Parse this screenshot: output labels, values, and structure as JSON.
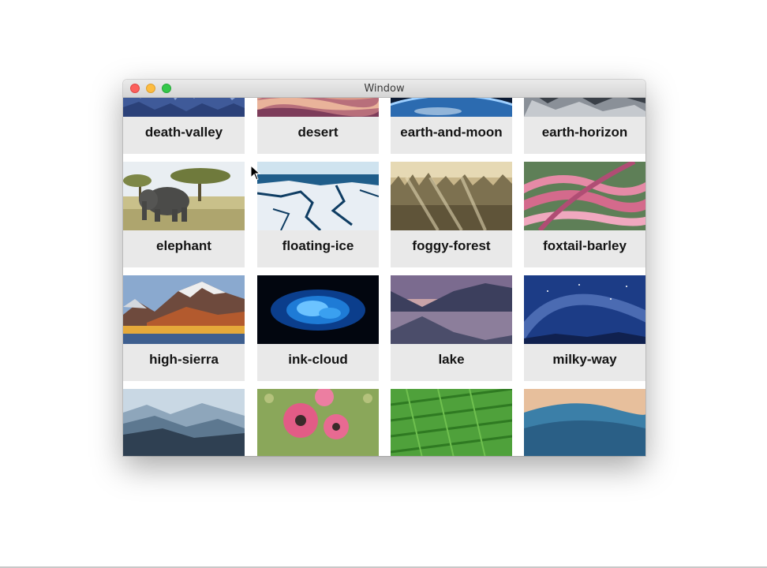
{
  "window": {
    "title": "Window"
  },
  "wallpapers": [
    {
      "label": "death-valley",
      "icon": "death-valley-thumbnail"
    },
    {
      "label": "desert",
      "icon": "desert-thumbnail"
    },
    {
      "label": "earth-and-moon",
      "icon": "earth-and-moon-thumbnail"
    },
    {
      "label": "earth-horizon",
      "icon": "earth-horizon-thumbnail"
    },
    {
      "label": "elephant",
      "icon": "elephant-thumbnail"
    },
    {
      "label": "floating-ice",
      "icon": "floating-ice-thumbnail"
    },
    {
      "label": "foggy-forest",
      "icon": "foggy-forest-thumbnail"
    },
    {
      "label": "foxtail-barley",
      "icon": "foxtail-barley-thumbnail"
    },
    {
      "label": "high-sierra",
      "icon": "high-sierra-thumbnail"
    },
    {
      "label": "ink-cloud",
      "icon": "ink-cloud-thumbnail"
    },
    {
      "label": "lake",
      "icon": "lake-thumbnail"
    },
    {
      "label": "milky-way",
      "icon": "milky-way-thumbnail"
    },
    {
      "icon": "misty-mountains-thumbnail"
    },
    {
      "icon": "poppy-flowers-thumbnail"
    },
    {
      "icon": "green-fields-thumbnail"
    },
    {
      "icon": "wave-thumbnail"
    }
  ]
}
